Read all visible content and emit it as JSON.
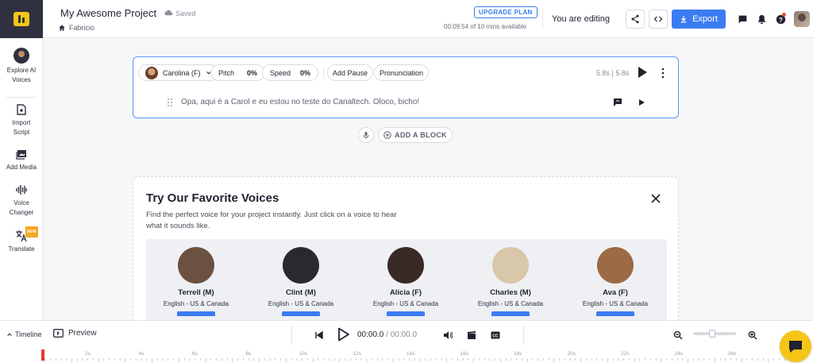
{
  "header": {
    "project_title": "My Awesome Project",
    "saved_label": "Saved",
    "breadcrumb": "Fabricio",
    "upgrade_label": "UPGRADE PLAN",
    "time_left": "00:09:54 of 10 mins available",
    "editing_label": "You are editing",
    "export_label": "Export"
  },
  "sidebar": {
    "items": [
      {
        "label": "Explore AI Voices"
      },
      {
        "label": "Import Script"
      },
      {
        "label": "Add Media"
      },
      {
        "label": "Voice Changer"
      },
      {
        "label": "Translate",
        "badge": "NEW"
      }
    ]
  },
  "block": {
    "voice": "Carolina (F)",
    "pitch_label": "Pitch",
    "pitch_value": "0%",
    "speed_label": "Speed",
    "speed_value": "0%",
    "add_pause": "Add Pause",
    "pronunciation": "Pronunciation",
    "duration": "5.8s | 5.8s",
    "text": "Opa, aqui é a Carol e eu estou no teste do Canaltech. Oloco, bicho!"
  },
  "add_block_label": "ADD A BLOCK",
  "favorites": {
    "title": "Try Our Favorite Voices",
    "description": "Find the perfect voice for your project instantly. Just click on a voice to hear what it sounds like.",
    "voices": [
      {
        "name": "Terrell (M)",
        "lang": "English - US & Canada"
      },
      {
        "name": "Clint (M)",
        "lang": "English - US & Canada"
      },
      {
        "name": "Alicia (F)",
        "lang": "English - US & Canada"
      },
      {
        "name": "Charles (M)",
        "lang": "English - US & Canada"
      },
      {
        "name": "Ava (F)",
        "lang": "English - US & Canada"
      }
    ]
  },
  "player": {
    "timeline_label": "Timeline",
    "preview_label": "Preview",
    "current_time": "00:00.0",
    "separator": " / ",
    "total_time": "00:00.0"
  },
  "ruler": {
    "ticks": [
      "2s",
      "4s",
      "6s",
      "8s",
      "10s",
      "12s",
      "14s",
      "16s",
      "18s",
      "20s",
      "22s",
      "24s",
      "26s"
    ]
  },
  "colors": {
    "accent": "#3b7cf2",
    "brand_yellow": "#f5c518",
    "sidebar_dark": "#2f3140"
  }
}
